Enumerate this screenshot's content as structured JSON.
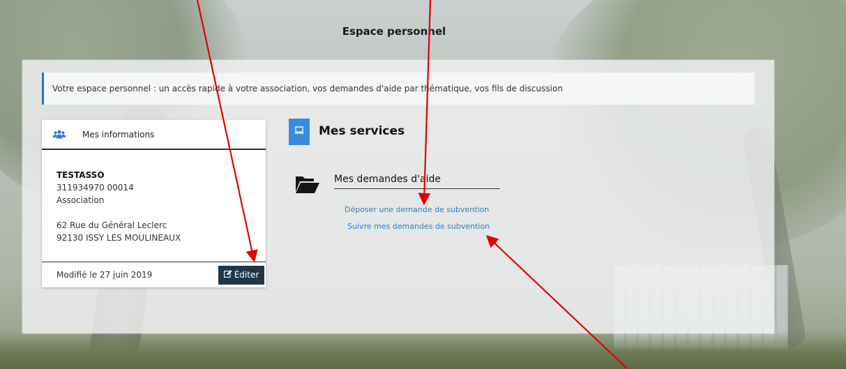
{
  "page": {
    "title": "Espace personnel"
  },
  "intro": {
    "text": "Votre espace personnel : un accès rapide à votre association, vos demandes d'aide par thématique, vos fils de discussion"
  },
  "info_card": {
    "header_icon": "users-icon",
    "title": "Mes informations",
    "name": "TESTASSO",
    "siret": "311934970 00014",
    "type": "Association",
    "address_line1": "62 Rue du Général Leclerc",
    "address_line2": "92130 ISSY LES MOULINEAUX",
    "modified": "Modifié le 27 juin 2019",
    "edit_icon": "edit-icon",
    "edit_label": "Éditer"
  },
  "services": {
    "icon": "laptop-icon",
    "title": "Mes services",
    "aid": {
      "icon": "folder-open-icon",
      "title": "Mes demandes d'aide",
      "links": [
        "Déposer une demande de subvention",
        "Suivre mes demandes de subvention"
      ]
    }
  },
  "colors": {
    "accent_blue": "#3a8be0",
    "link_blue": "#2e7bd1",
    "dark_navy": "#1f3648",
    "annotation_red": "#e10000"
  }
}
